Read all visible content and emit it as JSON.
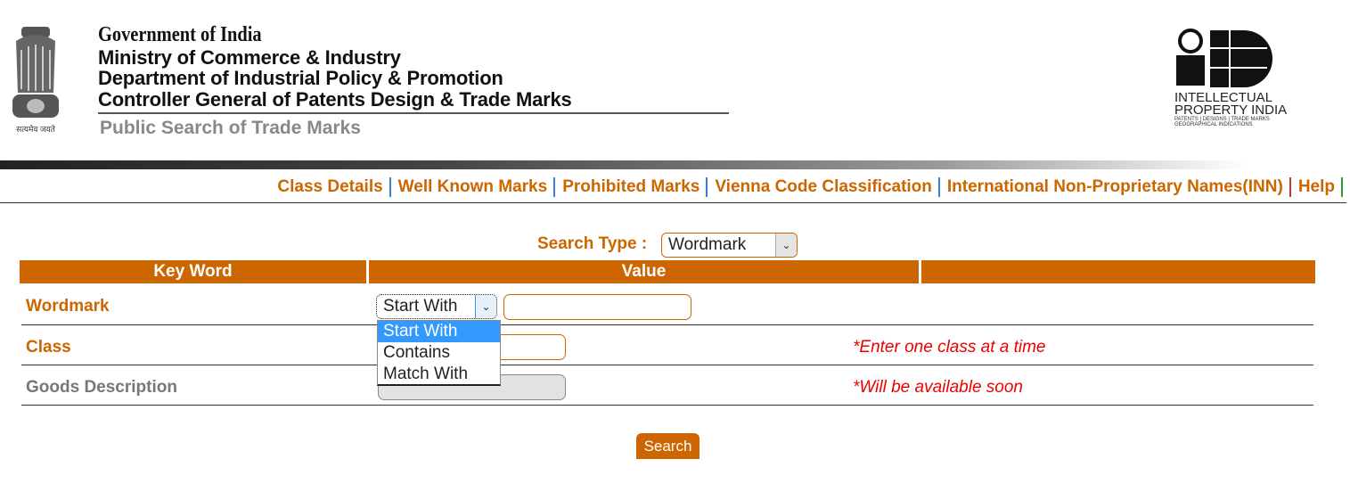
{
  "header": {
    "line1": "Government of India",
    "line2": "Ministry of Commerce & Industry",
    "line3": "Department of Industrial Policy & Promotion",
    "line4": "Controller General of Patents Design & Trade Marks",
    "subtitle": "Public Search of Trade Marks",
    "emblem_text": "सत्यमेव जयते",
    "ip_logo_text": [
      "INTELLECTUAL",
      "PROPERTY INDIA",
      "PATENTS | DESIGNS | TRADE MARKS",
      "GEOGRAPHICAL INDICATIONS"
    ]
  },
  "nav": [
    "Class Details",
    "Well Known Marks",
    "Prohibited Marks",
    "Vienna Code Classification",
    "International Non-Proprietary Names(INN)",
    "Help"
  ],
  "search_type": {
    "label": "Search Type :",
    "value": "Wordmark"
  },
  "table": {
    "headers": [
      "Key Word",
      "Value",
      ""
    ],
    "rows": [
      {
        "label": "Wordmark",
        "mode": "Start With",
        "value": ""
      },
      {
        "label": "Class",
        "value": "",
        "note": "*Enter one class at a time"
      },
      {
        "label": "Goods Description",
        "value": "",
        "note": "*Will be available soon"
      }
    ]
  },
  "dropdown_options": [
    "Start With",
    "Contains",
    "Match With"
  ],
  "search_button": "Search",
  "colors": {
    "accent": "#cc6600",
    "note": "#ee0000",
    "highlight": "#3399ff"
  }
}
